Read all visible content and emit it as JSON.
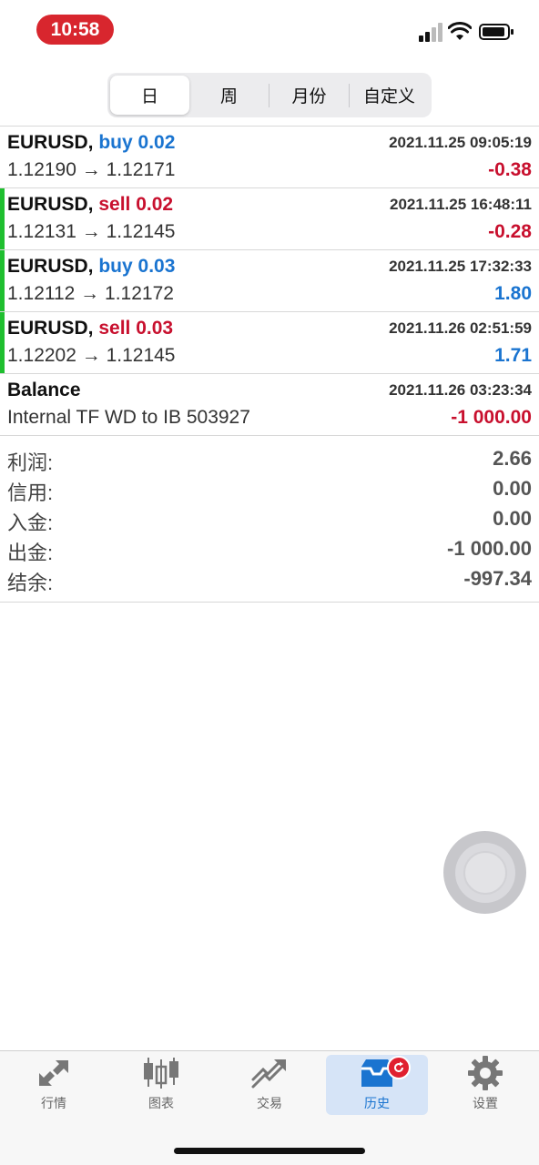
{
  "status_bar": {
    "time": "10:58"
  },
  "period_tabs": [
    {
      "label": "日",
      "active": true
    },
    {
      "label": "周",
      "active": false
    },
    {
      "label": "月份",
      "active": false
    },
    {
      "label": "自定义",
      "active": false
    }
  ],
  "deals": [
    {
      "symbol": "EURUSD,",
      "side": "buy",
      "volume": "0.02",
      "time": "2021.11.25 09:05:19",
      "prices": "1.12190 → 1.12171",
      "profit": "-0.38",
      "marker": false
    },
    {
      "symbol": "EURUSD,",
      "side": "sell",
      "volume": "0.02",
      "time": "2021.11.25 16:48:11",
      "prices": "1.12131 → 1.12145",
      "profit": "-0.28",
      "marker": true
    },
    {
      "symbol": "EURUSD,",
      "side": "buy",
      "volume": "0.03",
      "time": "2021.11.25 17:32:33",
      "prices": "1.12112 → 1.12172",
      "profit": "1.80",
      "marker": true
    },
    {
      "symbol": "EURUSD,",
      "side": "sell",
      "volume": "0.03",
      "time": "2021.11.26 02:51:59",
      "prices": "1.12202 → 1.12145",
      "profit": "1.71",
      "marker": true
    }
  ],
  "balance": {
    "title": "Balance",
    "time": "2021.11.26 03:23:34",
    "comment": "Internal TF WD to IB 503927",
    "amount": "-1 000.00"
  },
  "summary": [
    {
      "label": "利润:",
      "value": "2.66"
    },
    {
      "label": "信用:",
      "value": "0.00"
    },
    {
      "label": "入金:",
      "value": "0.00"
    },
    {
      "label": "出金:",
      "value": "-1 000.00"
    },
    {
      "label": "结余:",
      "value": "-997.34"
    }
  ],
  "tabbar": [
    {
      "label": "行情",
      "icon": "quotes-arrows-icon",
      "active": false
    },
    {
      "label": "图表",
      "icon": "candlestick-icon",
      "active": false
    },
    {
      "label": "交易",
      "icon": "trade-trend-icon",
      "active": false
    },
    {
      "label": "历史",
      "icon": "history-inbox-icon",
      "active": true
    },
    {
      "label": "设置",
      "icon": "gear-icon",
      "active": false
    }
  ],
  "colors": {
    "buy": "#1a74d0",
    "sell": "#c8102e",
    "marker": "#1fbf2f",
    "time_pill": "#d8262e"
  }
}
